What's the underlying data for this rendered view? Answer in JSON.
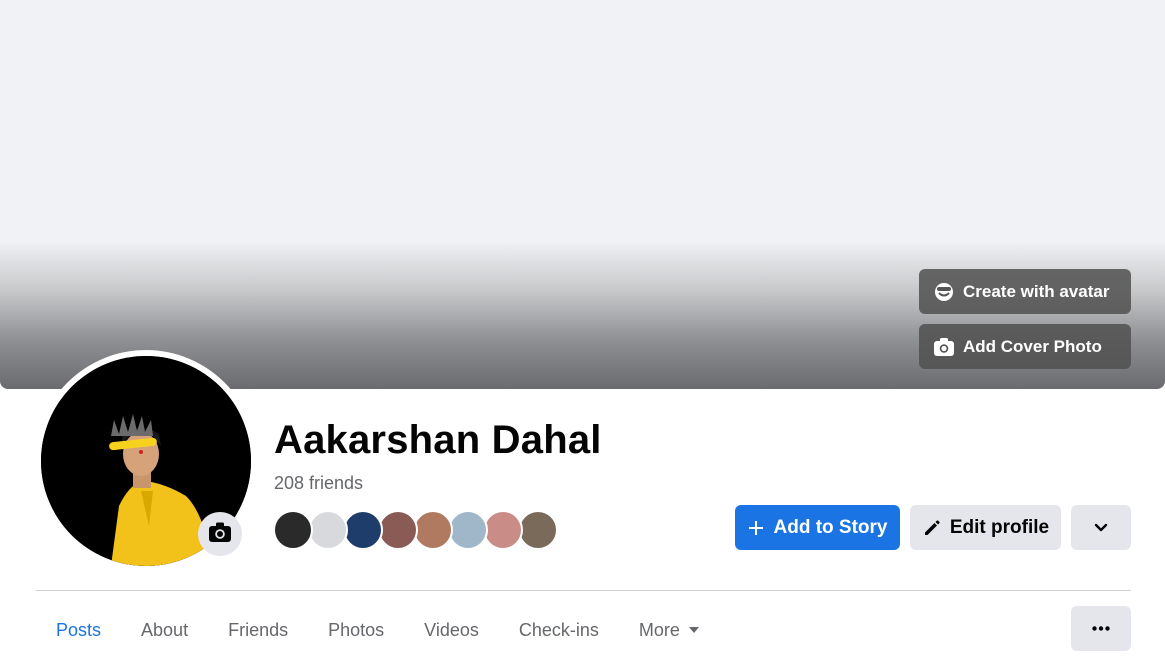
{
  "cover": {
    "create_avatar_label": "Create with avatar",
    "add_cover_label": "Add Cover Photo"
  },
  "profile": {
    "name": "Aakarshan Dahal",
    "friends_count": "208 friends",
    "friend_avatar_colors": [
      "#2a2a2a",
      "#d7d9dc",
      "#1f3d6b",
      "#8a5a55",
      "#b07a60",
      "#9fb7c9",
      "#c98c86",
      "#7a6a5a"
    ]
  },
  "actions": {
    "add_story_label": "Add to Story",
    "edit_profile_label": "Edit profile"
  },
  "tabs": [
    {
      "label": "Posts",
      "active": true
    },
    {
      "label": "About",
      "active": false
    },
    {
      "label": "Friends",
      "active": false
    },
    {
      "label": "Photos",
      "active": false
    },
    {
      "label": "Videos",
      "active": false
    },
    {
      "label": "Check-ins",
      "active": false
    },
    {
      "label": "More",
      "active": false
    }
  ],
  "colors": {
    "accent": "#1b74e4",
    "button_gray": "#e4e6eb",
    "secondary_text": "#65676b"
  }
}
